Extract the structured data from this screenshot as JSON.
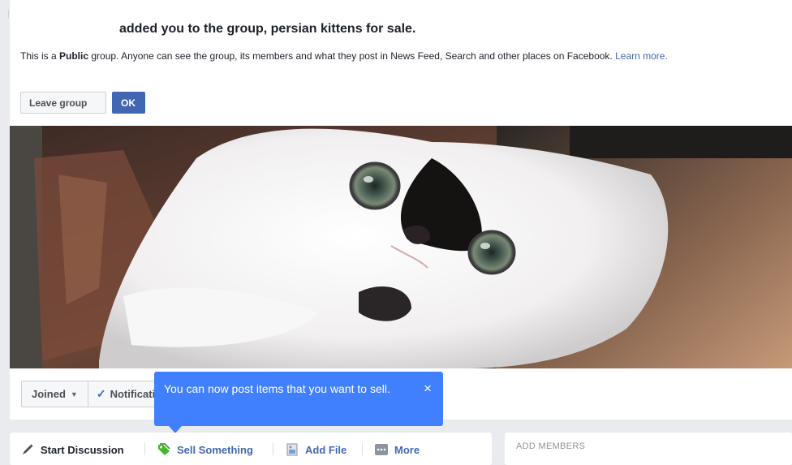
{
  "notice": {
    "title": "added you to the group, persian kittens for sale.",
    "body_prefix": "This is a ",
    "body_bold": "Public",
    "body_suffix": " group. Anyone can see the group, its members and what they post in News Feed, Search and other places on Facebook. ",
    "learn_more": "Learn more."
  },
  "buttons": {
    "leave_group": "Leave group",
    "ok": "OK"
  },
  "cover": {
    "subject": "white persian kitten photo"
  },
  "actionbar": {
    "joined": "Joined",
    "notifications": "Notifications"
  },
  "tooltip": {
    "text": "You can now post items that you want to sell.",
    "close": "×"
  },
  "composer": {
    "items": [
      {
        "label": "Start Discussion",
        "icon": "pencil-icon"
      },
      {
        "label": "Sell Something",
        "icon": "tag-icon"
      },
      {
        "label": "Add File",
        "icon": "file-icon"
      },
      {
        "label": "More",
        "icon": "more-icon"
      }
    ]
  },
  "members": {
    "label": "ADD MEMBERS"
  },
  "colors": {
    "brand": "#4267b2",
    "tooltip": "#4080ff",
    "sell_green": "#42b72a"
  }
}
